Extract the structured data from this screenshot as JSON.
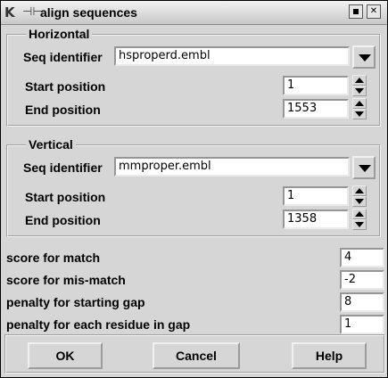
{
  "window": {
    "title": "align sequences",
    "logo_icon": "k-logo-icon",
    "pin_icon": "pin-icon"
  },
  "horizontal": {
    "legend": "Horizontal",
    "seq_label": "Seq identifier",
    "seq_value": "hsproperd.embl",
    "start_label": "Start position",
    "start_value": "1",
    "end_label": "End position",
    "end_value": "1553"
  },
  "vertical": {
    "legend": "Vertical",
    "seq_label": "Seq identifier",
    "seq_value": "mmproper.embl",
    "start_label": "Start position",
    "start_value": "1",
    "end_label": "End position",
    "end_value": "1358"
  },
  "params": [
    {
      "label": "score for match",
      "value": "4"
    },
    {
      "label": "score for mis-match",
      "value": "-2"
    },
    {
      "label": "penalty for starting gap",
      "value": "8"
    },
    {
      "label": "penalty for each residue in gap",
      "value": "1"
    }
  ],
  "buttons": {
    "ok": "OK",
    "cancel": "Cancel",
    "help": "Help"
  }
}
